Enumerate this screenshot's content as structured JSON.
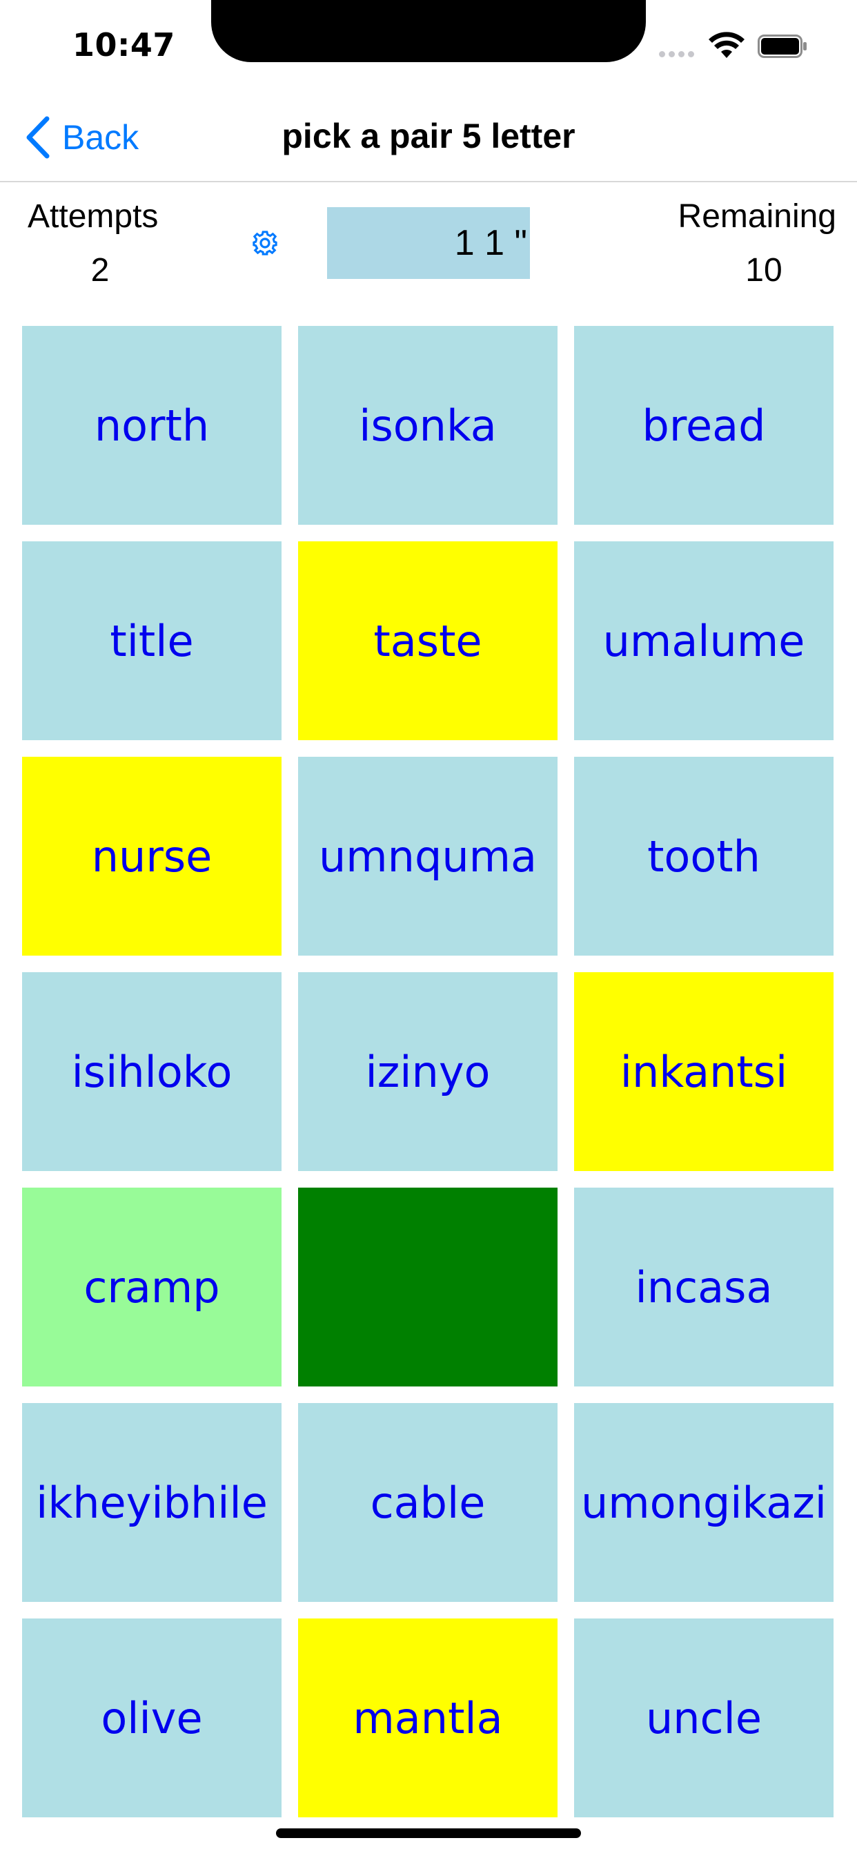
{
  "status_bar": {
    "time": "10:47"
  },
  "nav": {
    "back_label": "Back",
    "title": "pick a pair 5 letter"
  },
  "stats": {
    "attempts_label": "Attempts",
    "attempts_value": "2",
    "timer": "1 1 \"",
    "remaining_label": "Remaining",
    "remaining_value": "10"
  },
  "colors": {
    "tile_default": "#b0dfe5",
    "tile_selected": "#ffff00",
    "tile_active": "#98fb98",
    "tile_matched": "#008000",
    "tile_text": "#0000ee",
    "accent": "#007aff"
  },
  "icons": {
    "settings": "gear-icon",
    "back": "chevron-left-icon"
  },
  "tiles": [
    {
      "word": "north",
      "state": "default"
    },
    {
      "word": "isonka",
      "state": "default"
    },
    {
      "word": "bread",
      "state": "default"
    },
    {
      "word": "title",
      "state": "default"
    },
    {
      "word": "taste",
      "state": "selected"
    },
    {
      "word": "umalume",
      "state": "default"
    },
    {
      "word": "nurse",
      "state": "selected"
    },
    {
      "word": "umnquma",
      "state": "default"
    },
    {
      "word": "tooth",
      "state": "default"
    },
    {
      "word": "isihloko",
      "state": "default"
    },
    {
      "word": "izinyo",
      "state": "default"
    },
    {
      "word": "inkantsi",
      "state": "selected"
    },
    {
      "word": "cramp",
      "state": "active"
    },
    {
      "word": "",
      "state": "matched"
    },
    {
      "word": "incasa",
      "state": "default"
    },
    {
      "word": "ikheyibhile",
      "state": "default"
    },
    {
      "word": "cable",
      "state": "default"
    },
    {
      "word": "umongikazi",
      "state": "default"
    },
    {
      "word": "olive",
      "state": "default"
    },
    {
      "word": "mantla",
      "state": "selected"
    },
    {
      "word": "uncle",
      "state": "default"
    }
  ]
}
